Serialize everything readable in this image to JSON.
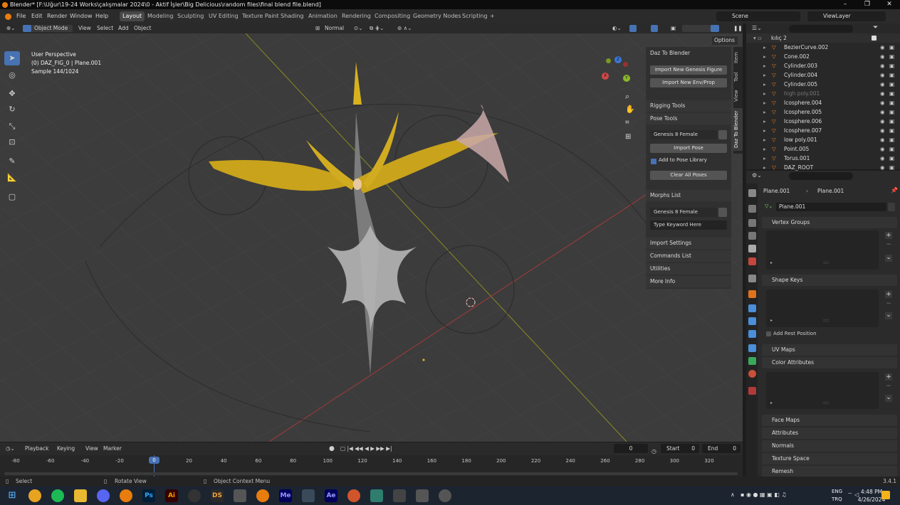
{
  "window": {
    "title": "Blender* [F:\\Uğur\\19-24 Works\\çalışmalar 2024\\0 - Aktif İşler\\Big Delicious\\random files\\final blend file.blend]",
    "minimize": "–",
    "maximize": "❐",
    "close": "✕"
  },
  "menu": [
    "File",
    "Edit",
    "Render",
    "Window",
    "Help"
  ],
  "workspaces": [
    "Layout",
    "Modeling",
    "Sculpting",
    "UV Editing",
    "Texture Paint",
    "Shading",
    "Animation",
    "Rendering",
    "Compositing",
    "Geometry Nodes",
    "Scripting"
  ],
  "workspace_add": "+",
  "scene": {
    "label": "Scene",
    "view_layer": "ViewLayer"
  },
  "viewport_header": {
    "mode": "Object Mode",
    "menus": [
      "View",
      "Select",
      "Add",
      "Object"
    ],
    "transform": "Normal",
    "options": "Options"
  },
  "viewport_overlay": {
    "view_name": "User Perspective",
    "object": "(0) DAZ_FIG_0 | Plane.001",
    "sample": "Sample 144/1024"
  },
  "gizmo_axes": {
    "x": "X",
    "y": "Y",
    "z": "Z"
  },
  "npanel": {
    "header": "Daz To Blender",
    "import_figure": "Import New Genesis Figure",
    "import_env": "Import New Env/Prop",
    "rigging": "Rigging Tools",
    "pose_tools": "Pose Tools",
    "figure_select": "Genesis 8 Female",
    "import_pose": "Import Pose",
    "add_pose_library": "Add to Pose Library",
    "clear_poses": "Clear All Poses",
    "morphs_list": "Morphs List",
    "morph_figure": "Genesis 8 Female",
    "keyword_placeholder": "Type Keyword Here",
    "import_settings": "Import Settings",
    "commands_list": "Commands List",
    "utilities": "Utilities",
    "more_info": "More Info"
  },
  "vtabs": [
    "Item",
    "Tool",
    "View",
    "Daz To Blender"
  ],
  "outliner": {
    "collection": "kılıç 2",
    "items": [
      "BezierCurve.002",
      "Cone.002",
      "Cylinder.003",
      "Cylinder.004",
      "Cylinder.005",
      "high poly.001",
      "Icosphere.004",
      "Icosphere.005",
      "Icosphere.006",
      "Icosphere.007",
      "low poly.001",
      "Point.005",
      "Torus.001",
      "DAZ_ROOT"
    ]
  },
  "properties": {
    "breadcrumb_a": "Plane.001",
    "breadcrumb_b": "Plane.001",
    "mesh_name": "Plane.001",
    "sections": [
      "Vertex Groups",
      "Shape Keys",
      "UV Maps",
      "Color Attributes",
      "Face Maps",
      "Attributes",
      "Normals",
      "Texture Space",
      "Remesh"
    ],
    "add_rest_position": "Add Rest Position",
    "list_add": "+",
    "list_remove": "−",
    "list_menu": "⌄",
    "list_expand": "▸",
    "list_grip": "::::"
  },
  "timeline": {
    "menus": [
      "Playback",
      "Keying",
      "View",
      "Marker"
    ],
    "current_frame": "0",
    "start_label": "Start",
    "start": "0",
    "end_label": "End",
    "end": "0",
    "ticks": [
      "-80",
      "-60",
      "-40",
      "-20",
      "0",
      "20",
      "40",
      "60",
      "80",
      "100",
      "120",
      "140",
      "160",
      "180",
      "200",
      "220",
      "240",
      "260",
      "280",
      "300",
      "320"
    ]
  },
  "statusbar": {
    "select": "Select",
    "rotate": "Rotate View",
    "context": "Object Context Menu",
    "version": "3.4.1"
  },
  "taskbar": {
    "apps": [
      "Ps",
      "Ai",
      "DS",
      "Me",
      "Ae"
    ],
    "lang": "ENG",
    "region": "TRQ",
    "time": "4:48 PM",
    "date": "4/26/2024"
  }
}
